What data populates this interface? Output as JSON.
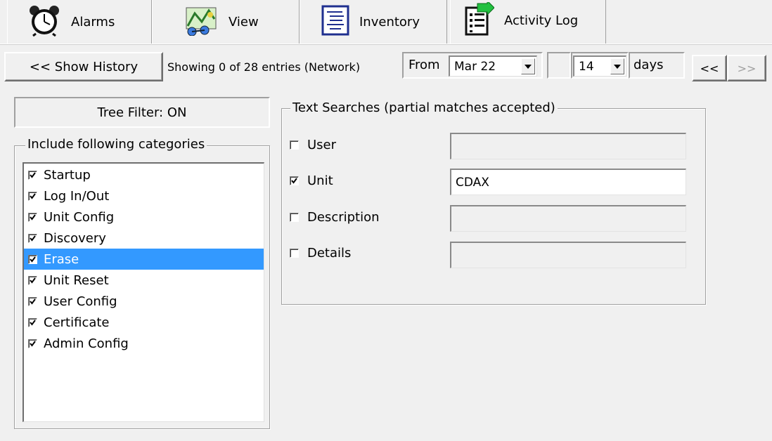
{
  "tabs": [
    {
      "label": "Alarms",
      "icon": "alarm-clock-icon"
    },
    {
      "label": "View",
      "icon": "map-icon"
    },
    {
      "label": "Inventory",
      "icon": "inventory-list-icon"
    },
    {
      "label": "Activity Log",
      "icon": "activity-log-icon",
      "active": true
    }
  ],
  "toolbar": {
    "show_history_label": "<< Show History",
    "status_text": "Showing 0 of 28 entries (Network)",
    "from_label": "From",
    "from_value": "Mar 22",
    "days_value": "14",
    "days_label": "days",
    "prev_label": "<<",
    "next_label": ">>"
  },
  "tree_filter_label": "Tree Filter: ON",
  "categories": {
    "legend": "Include following categories",
    "items": [
      {
        "label": "Startup",
        "checked": true
      },
      {
        "label": "Log In/Out",
        "checked": true
      },
      {
        "label": "Unit Config",
        "checked": true
      },
      {
        "label": "Discovery",
        "checked": true
      },
      {
        "label": "Erase",
        "checked": true,
        "selected": true
      },
      {
        "label": "Unit Reset",
        "checked": true
      },
      {
        "label": "User Config",
        "checked": true
      },
      {
        "label": "Certificate",
        "checked": true
      },
      {
        "label": "Admin Config",
        "checked": true
      }
    ]
  },
  "text_searches": {
    "legend": "Text Searches (partial matches accepted)",
    "fields": [
      {
        "label": "User",
        "checked": false,
        "value": ""
      },
      {
        "label": "Unit",
        "checked": true,
        "value": "CDAX"
      },
      {
        "label": "Description",
        "checked": false,
        "value": ""
      },
      {
        "label": "Details",
        "checked": false,
        "value": ""
      }
    ]
  },
  "colors": {
    "window_bg": "#f0f0f0",
    "selection": "#3399ff"
  }
}
